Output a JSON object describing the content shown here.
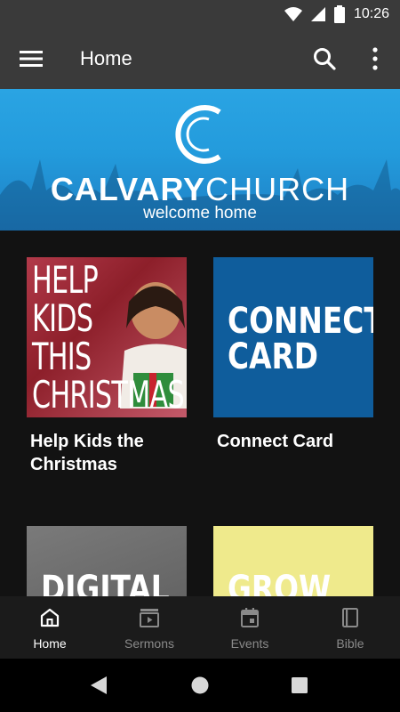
{
  "status_bar": {
    "time": "10:26",
    "icons": [
      "wifi-icon",
      "signal-icon",
      "battery-icon"
    ]
  },
  "app_bar": {
    "title": "Home",
    "icons": [
      "menu-icon",
      "search-icon",
      "more-vert-icon"
    ]
  },
  "banner": {
    "brand_bold": "CALVARY",
    "brand_light": "CHURCH",
    "tagline": "welcome home",
    "color": "#239bdc"
  },
  "cards": [
    {
      "thumb_lines": [
        "HELP",
        "KIDS",
        "THIS",
        "CHRISTMAS"
      ],
      "label": "Help Kids the Christmas"
    },
    {
      "thumb_lines": [
        "CONNECT",
        "CARD"
      ],
      "label": "Connect Card"
    },
    {
      "thumb_lines": [
        "DIGITAL"
      ],
      "label": ""
    },
    {
      "thumb_lines": [
        "GROW"
      ],
      "label": ""
    }
  ],
  "bottom_nav": {
    "items": [
      {
        "label": "Home",
        "icon": "home-icon",
        "active": true
      },
      {
        "label": "Sermons",
        "icon": "sermons-icon",
        "active": false
      },
      {
        "label": "Events",
        "icon": "calendar-icon",
        "active": false
      },
      {
        "label": "Bible",
        "icon": "book-icon",
        "active": false
      }
    ]
  },
  "colors": {
    "app_bar": "#3a3a3a",
    "background": "#121212",
    "nav_active": "#ffffff",
    "nav_inactive": "#8a8a8a"
  }
}
